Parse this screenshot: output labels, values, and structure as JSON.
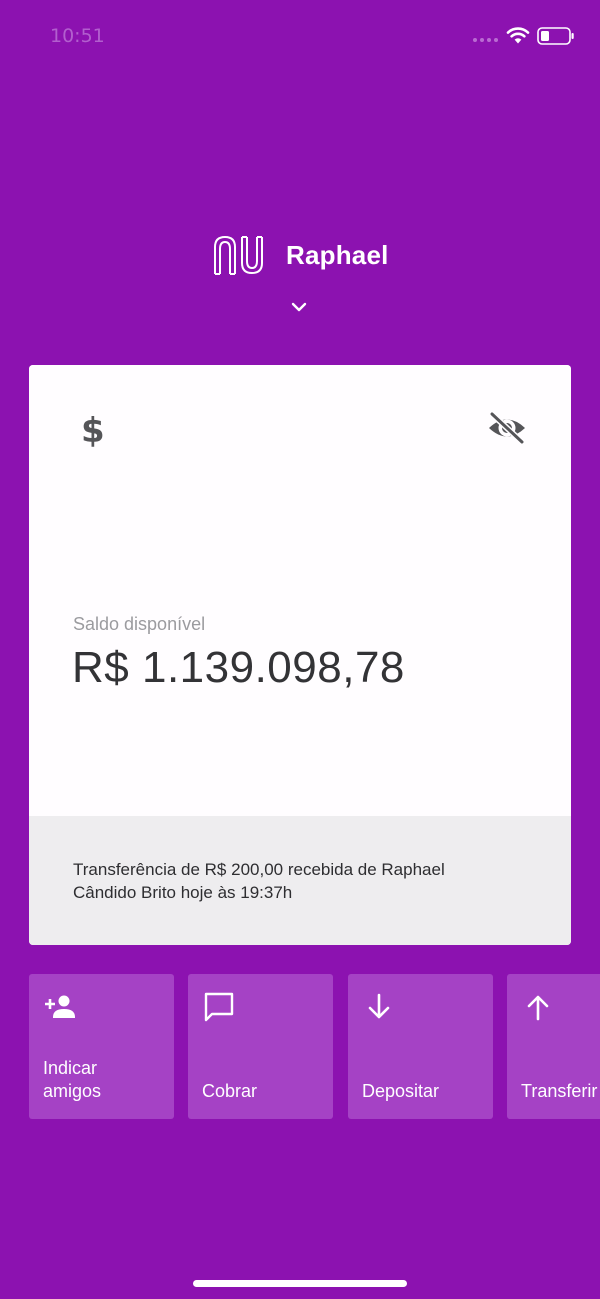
{
  "status_bar": {
    "time": "10:51",
    "icons": [
      "signal-dots-icon",
      "wifi-icon",
      "battery-icon"
    ]
  },
  "header": {
    "logo": "nu-logo",
    "account_name": "Raphael",
    "chevron_icon": "chevron-down-icon"
  },
  "card": {
    "top_left_icon": "dollar-icon",
    "top_right_icon": "eye-off-icon",
    "balance_label": "Saldo disponível",
    "balance_value": "R$ 1.139.098,78",
    "notice": "Transferência de R$ 200,00 recebida de Raphael Cândido Brito hoje às 19:37h"
  },
  "shortcuts": [
    {
      "label": "Indicar\namigos",
      "icon": "add-person-icon"
    },
    {
      "label": "Cobrar",
      "icon": "chat-bubble-icon"
    },
    {
      "label": "Depositar",
      "icon": "arrow-down-icon"
    },
    {
      "label": "Transferir",
      "icon": "arrow-up-icon"
    }
  ],
  "colors": {
    "background": "#8C12B0",
    "tile": "#A542C5",
    "card": "#FFFFFF",
    "card_footer": "#EEEDEF"
  }
}
